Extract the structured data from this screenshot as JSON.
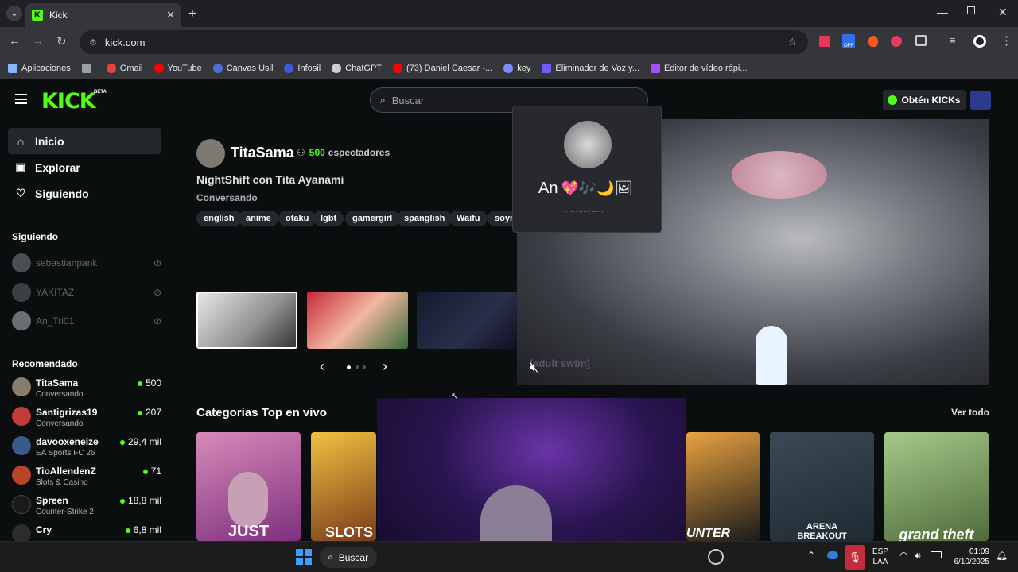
{
  "browser": {
    "tab_title": "Kick",
    "new_tab": "+",
    "address": "kick.com",
    "bookmarks": [
      {
        "label": "Aplicaciones",
        "color": "#8ab4f8"
      },
      {
        "label": "",
        "color": "#9aa0a6"
      },
      {
        "label": "Gmail",
        "color": "#ea4335"
      },
      {
        "label": "YouTube",
        "color": "#ff0000"
      },
      {
        "label": "Canvas Usil",
        "color": "#4a6fd8"
      },
      {
        "label": "Infosil",
        "color": "#3b5bdb"
      },
      {
        "label": "ChatGPT",
        "color": "#cfcfcf"
      },
      {
        "label": "(73) Daniel Caesar -...",
        "color": "#ff0000"
      },
      {
        "label": "key",
        "color": "#7c8cff"
      },
      {
        "label": "Eliminador de Voz y...",
        "color": "#6d5dfc"
      },
      {
        "label": "Editor de vídeo rápi...",
        "color": "#a64dff"
      }
    ]
  },
  "header": {
    "logo": "KICK",
    "beta": "BETA",
    "search_placeholder": "Buscar",
    "get_kicks": "Obtén KICKs"
  },
  "sidebar": {
    "nav": [
      {
        "label": "Inicio",
        "icon": "home-icon"
      },
      {
        "label": "Explorar",
        "icon": "compass-icon"
      },
      {
        "label": "Siguiendo",
        "icon": "heart-icon"
      }
    ],
    "following_title": "Siguiendo",
    "following": [
      "sebastianpank",
      "YAKITAZ",
      "An_Tri01"
    ],
    "recommended_title": "Recomendado",
    "recommended": [
      {
        "name": "TitaSama",
        "category": "Conversando",
        "viewers": "500"
      },
      {
        "name": "Santigrizas19",
        "category": "Conversando",
        "viewers": "207"
      },
      {
        "name": "davooxeneize",
        "category": "EA Sports FC 26",
        "viewers": "29,4 mil"
      },
      {
        "name": "TioAllendenZ",
        "category": "Slots & Casino",
        "viewers": "71"
      },
      {
        "name": "Spreen",
        "category": "Counter-Strike 2",
        "viewers": "18,8 mil"
      },
      {
        "name": "Cry",
        "category": "",
        "viewers": "6,8 mil"
      }
    ]
  },
  "featured": {
    "streamer": "TitaSama",
    "viewers": "500",
    "viewers_label": "espectadores",
    "title": "NightShift con Tita Ayanami",
    "category": "Conversando",
    "tags": [
      "english",
      "anime",
      "otaku",
      "lgbt",
      "gamergirl",
      "spanglish",
      "Waifu",
      "soyn"
    ]
  },
  "popup": {
    "name": "An",
    "emojis": "💖🎶🌙🖼",
    "dots": "..............."
  },
  "player_overlay_text": "[adult swim]",
  "categories_title": "Categorías Top en vivo",
  "see_all": "Ver todo",
  "categories": [
    {
      "label": "JUST",
      "color1": "#a24db0",
      "color2": "#d98bbb"
    },
    {
      "label": "SLOTS",
      "color1": "#7a3b1a",
      "color2": "#f0c040"
    },
    {
      "label": "UNTER",
      "color1": "#1a1a1a",
      "color2": "#d07d20"
    },
    {
      "label": "ARENA BREAKOUT",
      "color1": "#1f2a33",
      "color2": "#3b4a55"
    },
    {
      "label": "grand theft",
      "color1": "#a5c98a",
      "color2": "#4f6b3a"
    }
  ],
  "taskbar": {
    "search": "Buscar",
    "lang": "ESP",
    "lang2": "LAA",
    "time": "01:09",
    "date": "6/10/2025"
  }
}
